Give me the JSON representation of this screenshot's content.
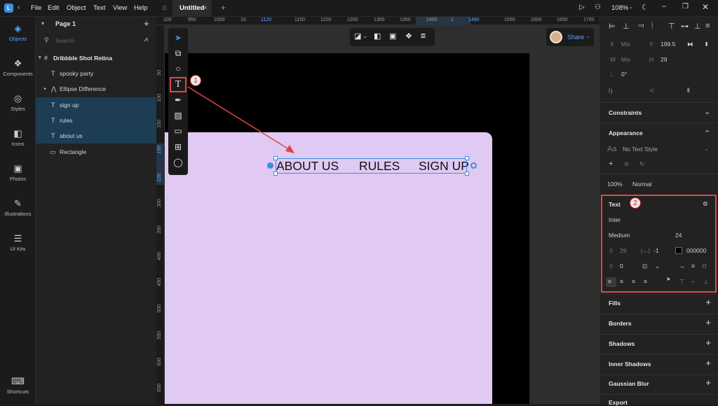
{
  "menubar": {
    "items": [
      "File",
      "Edit",
      "Object",
      "Text",
      "View",
      "Help"
    ],
    "tab_title": "Untitled",
    "zoom": "108%"
  },
  "left_rail": {
    "items": [
      {
        "label": "Objects",
        "icon": "layers-icon",
        "glyph": "◈"
      },
      {
        "label": "Components",
        "icon": "components-icon",
        "glyph": "❖"
      },
      {
        "label": "Styles",
        "icon": "styles-icon",
        "glyph": "◎"
      },
      {
        "label": "Icons",
        "icon": "icons-icon",
        "glyph": "◧"
      },
      {
        "label": "Photos",
        "icon": "photos-icon",
        "glyph": "▣"
      },
      {
        "label": "Illustrations",
        "icon": "illustrations-icon",
        "glyph": "✎"
      },
      {
        "label": "UI Kits",
        "icon": "ui-kits-icon",
        "glyph": "☰"
      }
    ],
    "shortcuts_label": "Shortcuts"
  },
  "layers": {
    "page_label": "Page 1",
    "search_placeholder": "Search",
    "items": [
      {
        "label": "Dribbble Shot Retina",
        "glyph": "#"
      },
      {
        "label": "spooky party",
        "glyph": "T"
      },
      {
        "label": "Ellipse Difference",
        "glyph": "⋀"
      },
      {
        "label": "sign up",
        "glyph": "T"
      },
      {
        "label": "rules",
        "glyph": "T"
      },
      {
        "label": "about us",
        "glyph": "T"
      },
      {
        "label": "Rectangle",
        "glyph": "▭"
      }
    ]
  },
  "rulers": {
    "top": [
      "100",
      "950",
      "1000",
      "10",
      "1120",
      "1150",
      "1200",
      "1250",
      "1300",
      "1350",
      "1400",
      "1",
      "1480",
      "1550",
      "1600",
      "1650",
      "1700"
    ],
    "left": [
      "50",
      "100",
      "150",
      "199",
      "228",
      "300",
      "350",
      "400",
      "450",
      "500",
      "550",
      "600",
      "650"
    ]
  },
  "canvas": {
    "nav_items": [
      "ABOUT US",
      "RULES",
      "SIGN UP"
    ]
  },
  "share": {
    "label": "Share"
  },
  "annotations": {
    "badge1": "1",
    "badge2": "2"
  },
  "properties": {
    "x_label": "X",
    "x_value": "Mix",
    "y_label": "Y",
    "y_value": "199.5",
    "w_label": "W",
    "w_value": "Mix",
    "h_label": "H",
    "h_value": "29",
    "rotation": "0°",
    "constraints": "Constraints",
    "appearance": "Appearance",
    "text_style": "No Text Style",
    "opacity": "100%",
    "blend": "Normal",
    "text_header": "Text",
    "font_family": "Inter",
    "font_weight": "Medium",
    "font_size": "24",
    "line_height": "29",
    "letter_spacing": "-1",
    "color_hex": "000000",
    "para_spacing": "0",
    "fills": "Fills",
    "borders": "Borders",
    "shadows": "Shadows",
    "inner_shadows": "Inner Shadows",
    "gaussian_blur": "Gaussian Blur",
    "export": "Export"
  },
  "colors": {
    "accent": "#3b8fe0",
    "artboard": "#e0c9f2",
    "highlight": "#e04646"
  }
}
